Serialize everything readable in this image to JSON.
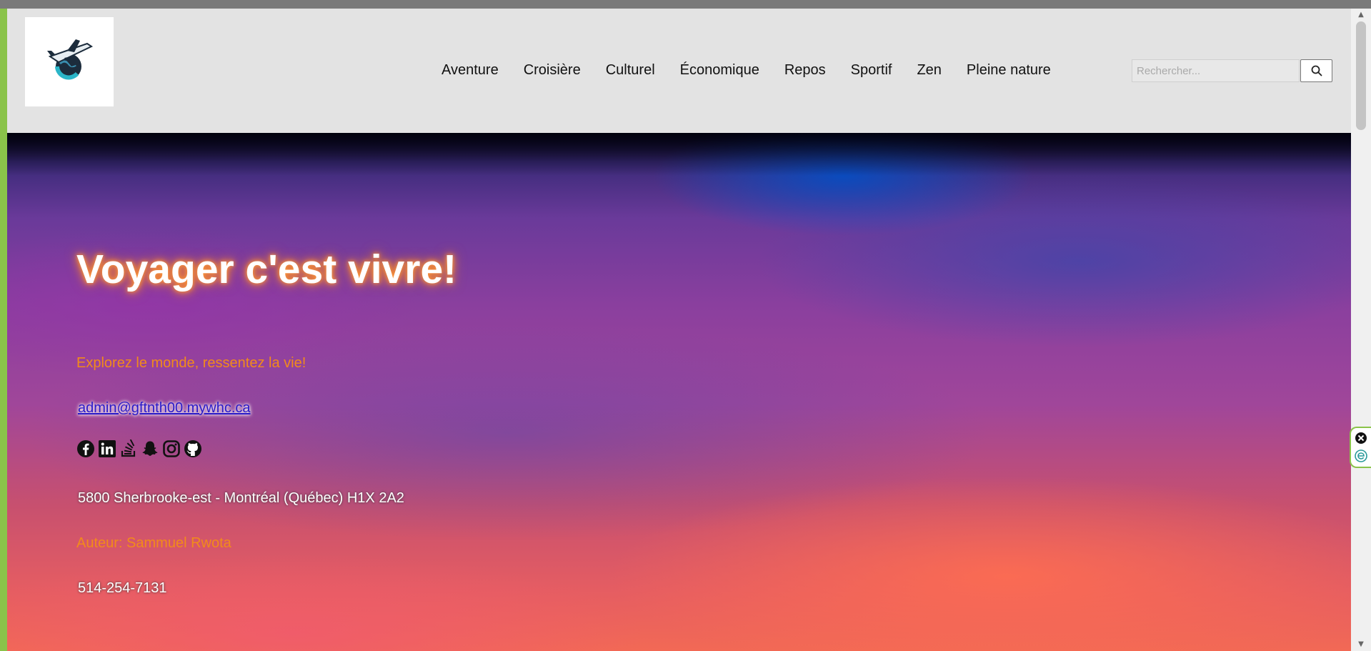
{
  "header": {
    "logo_alt": "airplane-globe-logo",
    "nav": [
      "Aventure",
      "Croisière",
      "Culturel",
      "Économique",
      "Repos",
      "Sportif",
      "Zen",
      "Pleine nature"
    ],
    "search_placeholder": "Rechercher..."
  },
  "hero": {
    "title": "Voyager c'est vivre!",
    "tagline": "Explorez le monde, ressentez la vie!",
    "email": "admin@gftnth00.mywhc.ca",
    "social_icons": [
      "facebook-icon",
      "linkedin-icon",
      "stackoverflow-icon",
      "snapchat-icon",
      "instagram-icon",
      "github-icon"
    ],
    "address": "5800 Sherbrooke-est - Montréal (Québec) H1X 2A2",
    "author": "Auteur: Sammuel Rwota",
    "phone": "514-254-7131"
  },
  "colors": {
    "header_bg": "#e3e3e3",
    "accent_orange": "#f28b1a",
    "link_blue": "#2a1ac8",
    "frame_green": "#8ac34a"
  }
}
